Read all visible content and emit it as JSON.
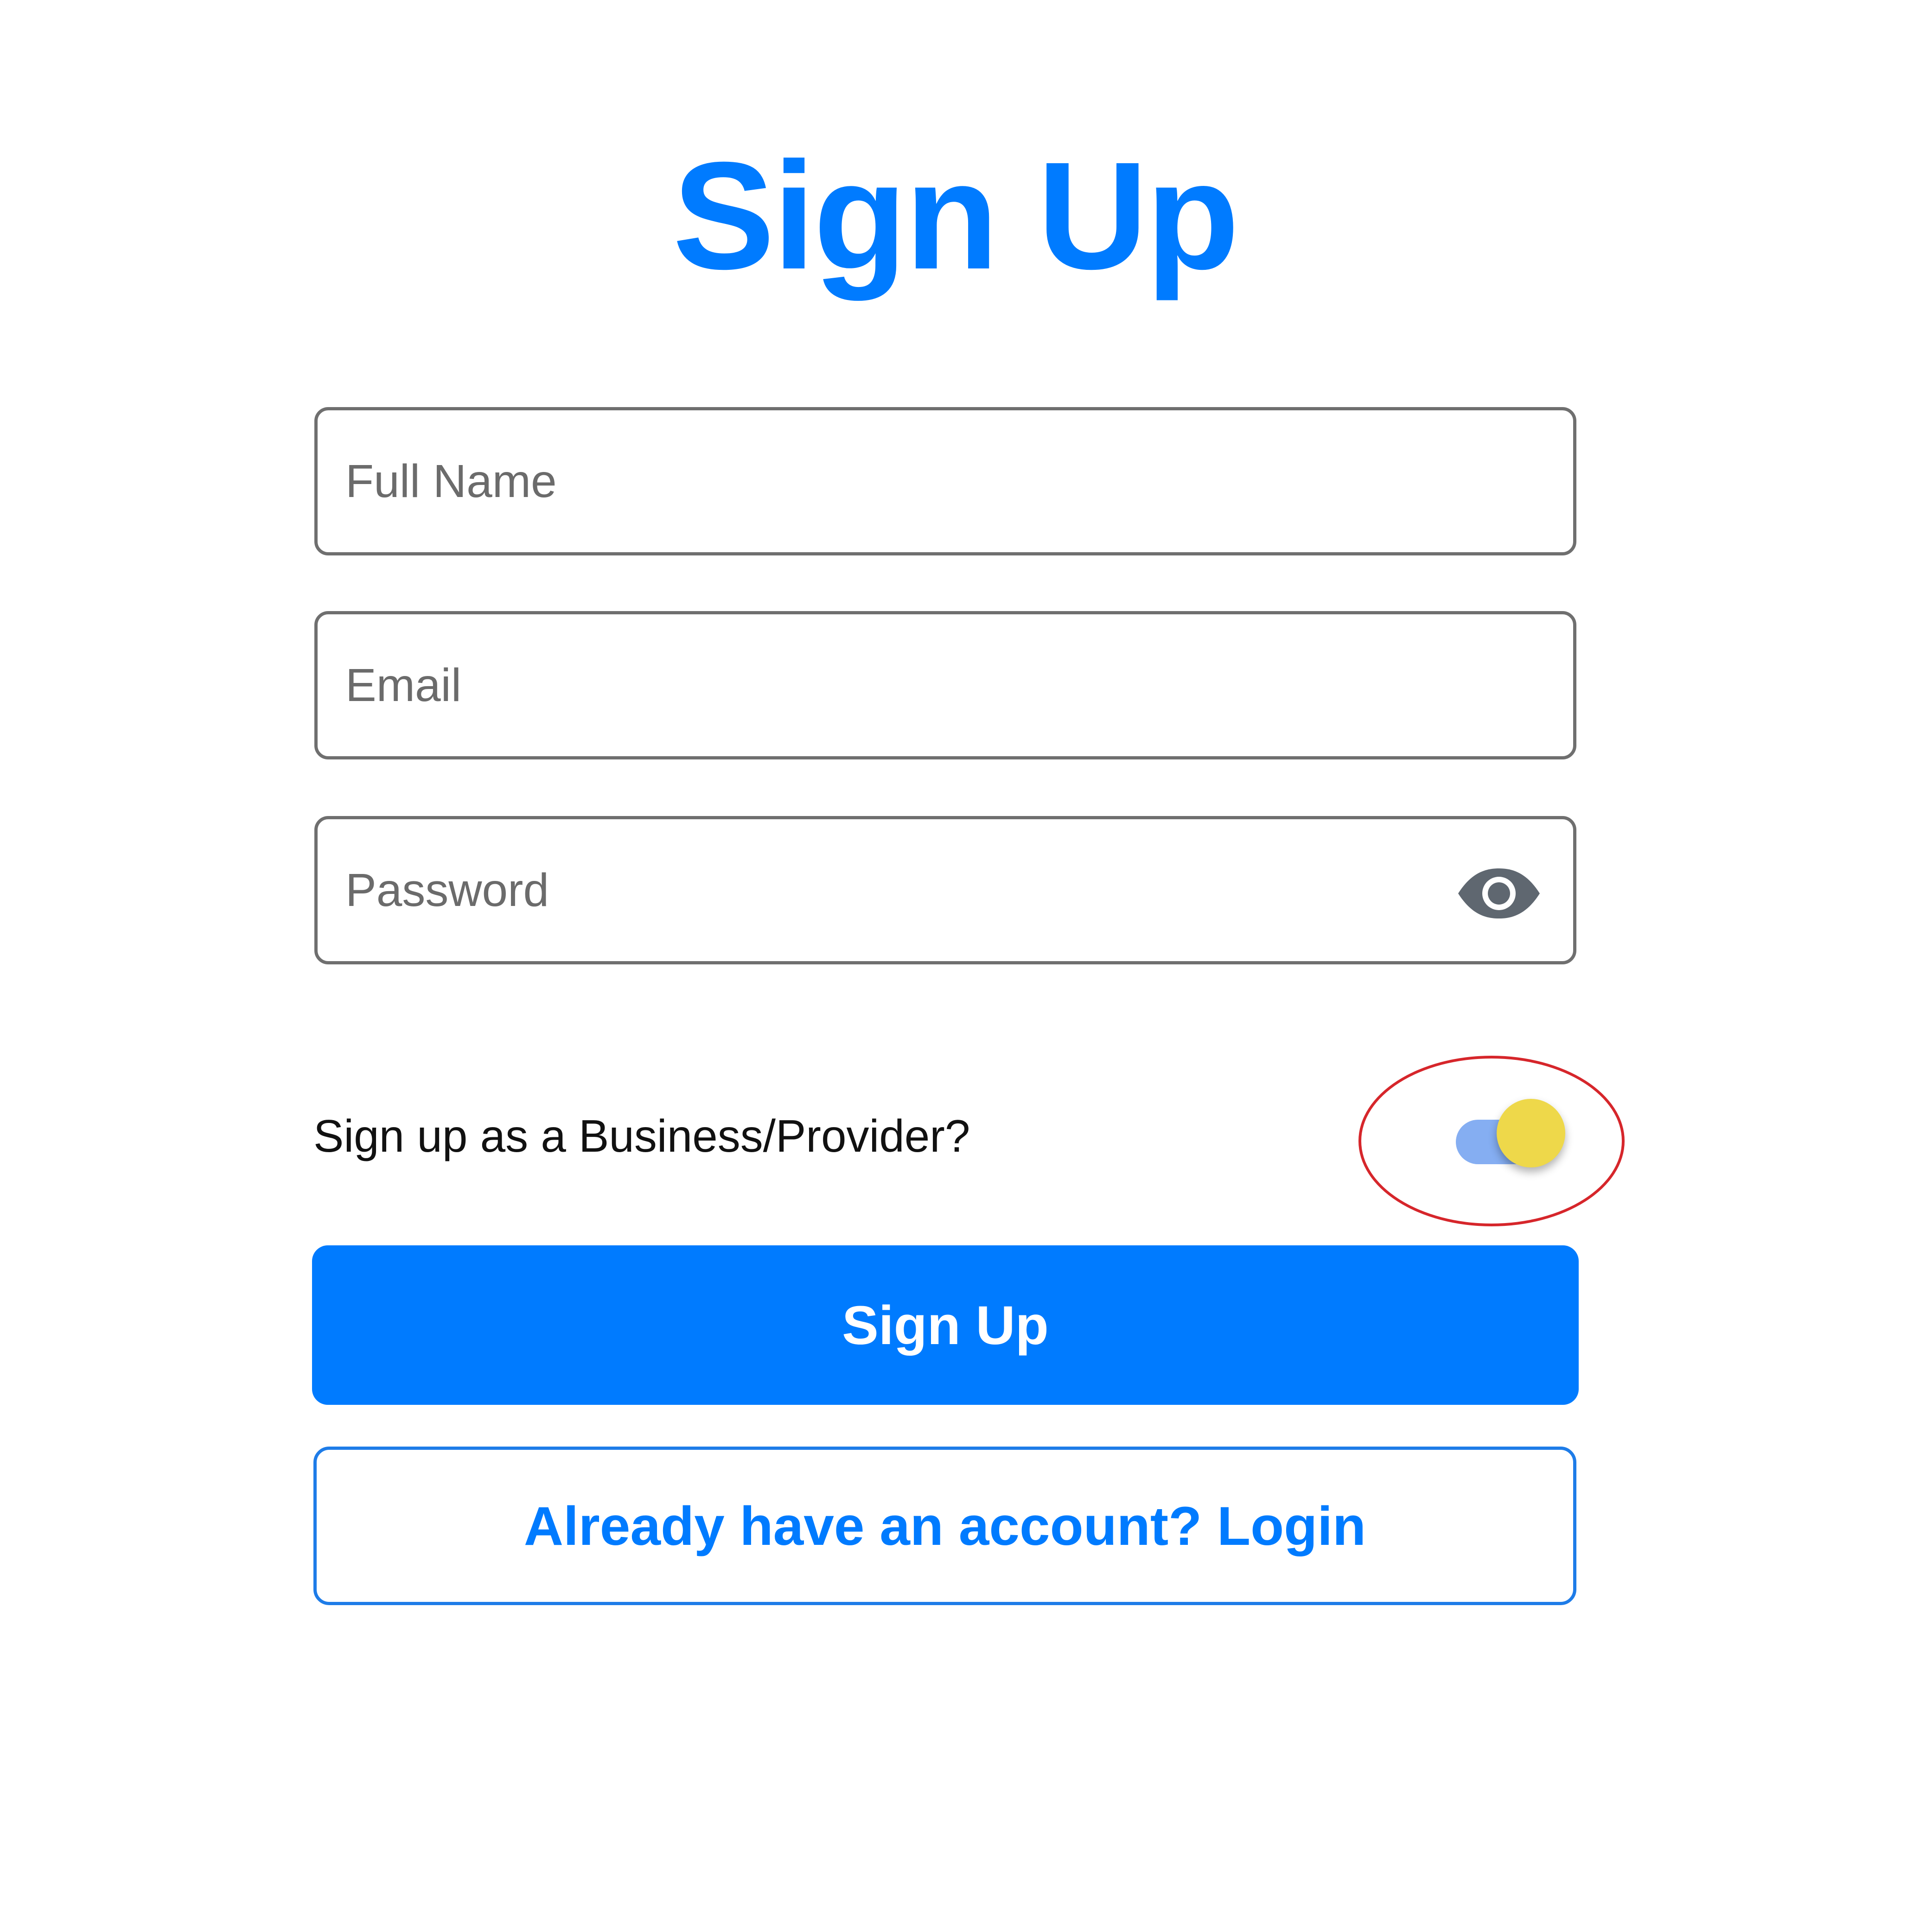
{
  "page": {
    "title": "Sign Up"
  },
  "form": {
    "full_name": {
      "placeholder": "Full Name",
      "value": ""
    },
    "email": {
      "placeholder": "Email",
      "value": ""
    },
    "password": {
      "placeholder": "Password",
      "value": "",
      "toggle_icon": "eye-icon"
    }
  },
  "business_toggle": {
    "label": "Sign up as a Business/Provider?",
    "checked": true,
    "track_color": "#85aef2",
    "thumb_color": "#eed84a",
    "highlight_color": "#d6262b"
  },
  "actions": {
    "signup_label": "Sign Up",
    "login_label": "Already have an account? Login"
  },
  "colors": {
    "accent": "#007BFF",
    "field_border": "#6f6f6f",
    "placeholder": "#6b6b6b",
    "background": "#ffffff"
  }
}
